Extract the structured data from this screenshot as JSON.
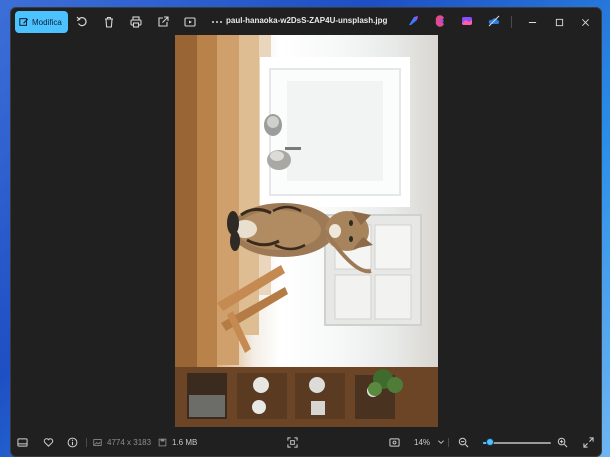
{
  "titlebar": {
    "edit_label": "Modifica",
    "filename": "paul-hanaoka-w2DsS-ZAP4U-unsplash.jpg",
    "tools": [
      "rotate-icon",
      "delete-icon",
      "print-icon",
      "share-icon",
      "slideshow-icon",
      "more-icon"
    ],
    "app_icons": [
      "designer-icon",
      "clipchamp-icon",
      "photos-icon",
      "onedrive-icon"
    ],
    "window_controls": [
      "minimize-icon",
      "maximize-icon",
      "close-icon"
    ]
  },
  "image": {
    "subject": "cat-photo"
  },
  "statusbar": {
    "dimensions": "4774 x 3183",
    "filesize": "1.6 MB",
    "zoom": "14%",
    "zoom_level": 0.1
  },
  "colors": {
    "accent": "#4cc2ff",
    "window_bg": "#202020"
  }
}
